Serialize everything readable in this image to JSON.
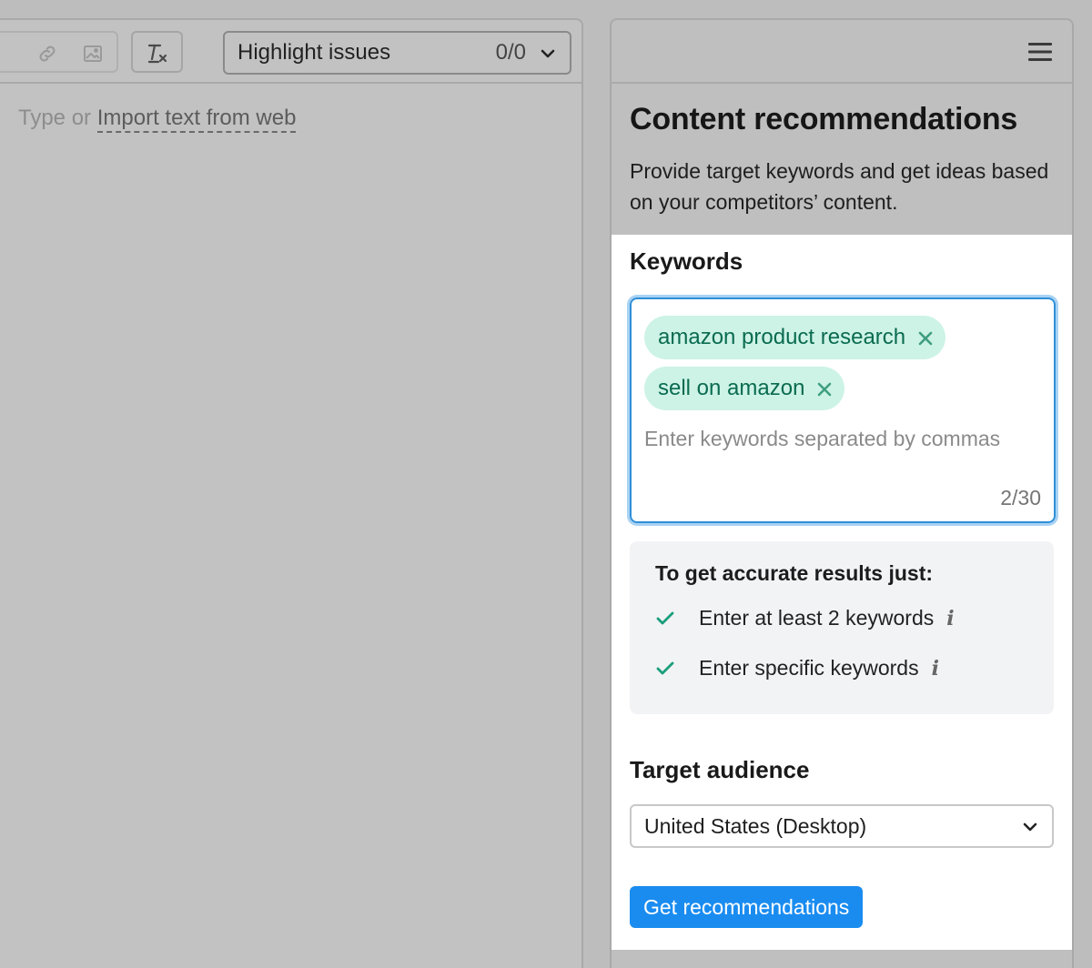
{
  "editor": {
    "toolbar": {
      "link_icon": "link-icon",
      "image_icon": "image-icon",
      "clear_format_icon": "clear-formatting-icon",
      "highlight_label": "Highlight issues",
      "highlight_count": "0/0"
    },
    "placeholder_prefix": "Type or",
    "import_link": "Import text from web"
  },
  "panel": {
    "menu_icon": "hamburger-menu-icon",
    "title": "Content recommendations",
    "description": "Provide target keywords and get ideas based on your competitors’ content.",
    "keywords": {
      "title": "Keywords",
      "chips": [
        "amazon product research",
        "sell on amazon"
      ],
      "placeholder": "Enter keywords separated by commas",
      "counter": "2/30"
    },
    "tips": {
      "title": "To get accurate results just:",
      "items": [
        "Enter at least 2 keywords",
        "Enter specific keywords"
      ],
      "info_glyph": "i"
    },
    "audience": {
      "title": "Target audience",
      "selected": "United States (Desktop)"
    },
    "cta_label": "Get recommendations"
  },
  "colors": {
    "accent": "#1a8cf0",
    "chip_bg": "#cdf3e6",
    "chip_text": "#0a6b50",
    "check": "#1a9e7c",
    "focus_border": "#2f8fd8"
  }
}
